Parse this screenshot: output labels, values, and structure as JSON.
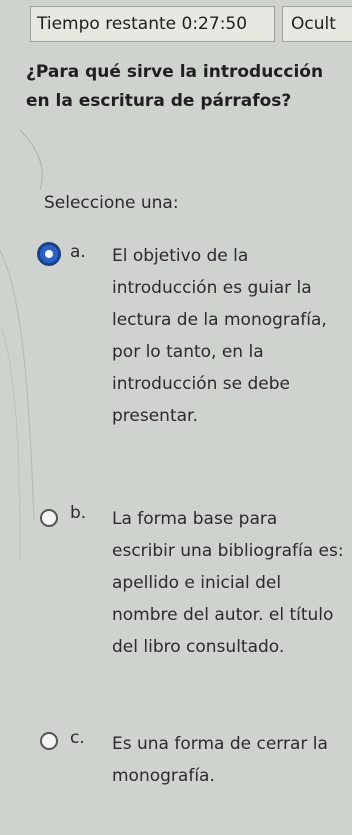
{
  "timer": {
    "label": "Tiempo restante 0:27:50"
  },
  "hide_button": {
    "label": "Ocult"
  },
  "question": {
    "text": "¿Para qué sirve la introducción en la escritura de párrafos?"
  },
  "prompt": {
    "text": "Seleccione una:"
  },
  "options": [
    {
      "letter": "a.",
      "text": "El objetivo de la introducción es guiar la lectura de la monografía, por lo tanto, en la introducción se debe presentar.",
      "selected": true
    },
    {
      "letter": "b.",
      "text": "La forma base para escribir una bibliografía es: apellido e inicial del nombre del autor. el título del libro consultado.",
      "selected": false
    },
    {
      "letter": "c.",
      "text": "Es una forma de cerrar la monografía.",
      "selected": false
    }
  ]
}
